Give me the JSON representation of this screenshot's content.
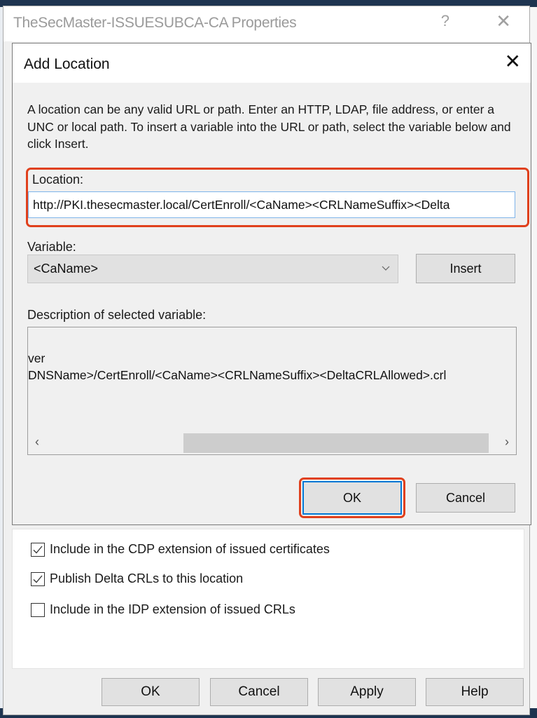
{
  "properties_window": {
    "title": "TheSecMaster-ISSUESUBCA-CA Properties",
    "help_glyph": "?",
    "close_glyph": "✕",
    "checkboxes": [
      {
        "label": "Include in the CDP extension of issued certificates",
        "checked": true
      },
      {
        "label": "Publish Delta CRLs to this location",
        "checked": true
      },
      {
        "label": "Include in the IDP extension of issued CRLs",
        "checked": false
      }
    ],
    "buttons": {
      "ok": "OK",
      "cancel": "Cancel",
      "apply": "Apply",
      "help": "Help"
    }
  },
  "add_location_dialog": {
    "title": "Add Location",
    "close_glyph": "✕",
    "description": "A location can be any valid URL or path. Enter an HTTP, LDAP, file address, or enter a UNC or local path. To insert a variable into the URL or path, select the variable below and click Insert.",
    "location_label": "Location:",
    "location_value": "http://PKI.thesecmaster.local/CertEnroll/<CaName><CRLNameSuffix><Delta",
    "variable_label": "Variable:",
    "variable_selected": "<CaName>",
    "insert_button": "Insert",
    "description_label": "Description of selected variable:",
    "variable_description_lines": [
      "ver",
      "DNSName>/CertEnroll/<CaName><CRLNameSuffix><DeltaCRLAllowed>.crl"
    ],
    "scroll_left_glyph": "‹",
    "scroll_right_glyph": "›",
    "ok_button": "OK",
    "cancel_button": "Cancel",
    "highlight_color": "#e0401c"
  }
}
